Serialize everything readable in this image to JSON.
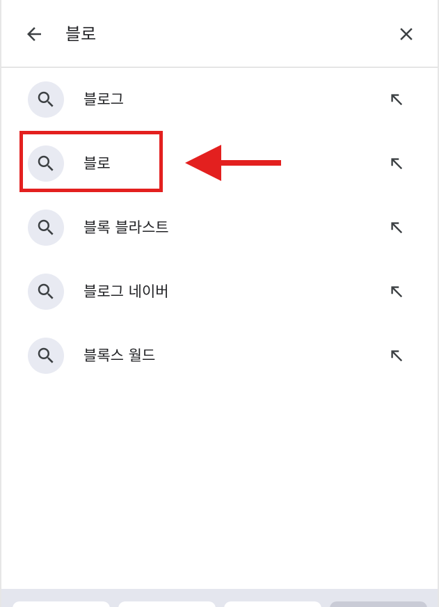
{
  "header": {
    "query": "블로",
    "back_icon": "arrow-left-icon",
    "clear_icon": "close-icon"
  },
  "suggestions": [
    {
      "label": "블로그"
    },
    {
      "label": "블로"
    },
    {
      "label": "블록 블라스트"
    },
    {
      "label": "블로그 네이버"
    },
    {
      "label": "블록스 월드"
    }
  ],
  "icons": {
    "suggestion_icon": "search-icon",
    "fill_icon": "arrow-up-left-icon"
  },
  "annotation": {
    "highlight_color": "#e3201f",
    "highlighted_index": 1
  },
  "colors": {
    "icon_bubble": "#e8eaf2",
    "text": "#202124",
    "bottom_strip": "#e4e6ee"
  }
}
